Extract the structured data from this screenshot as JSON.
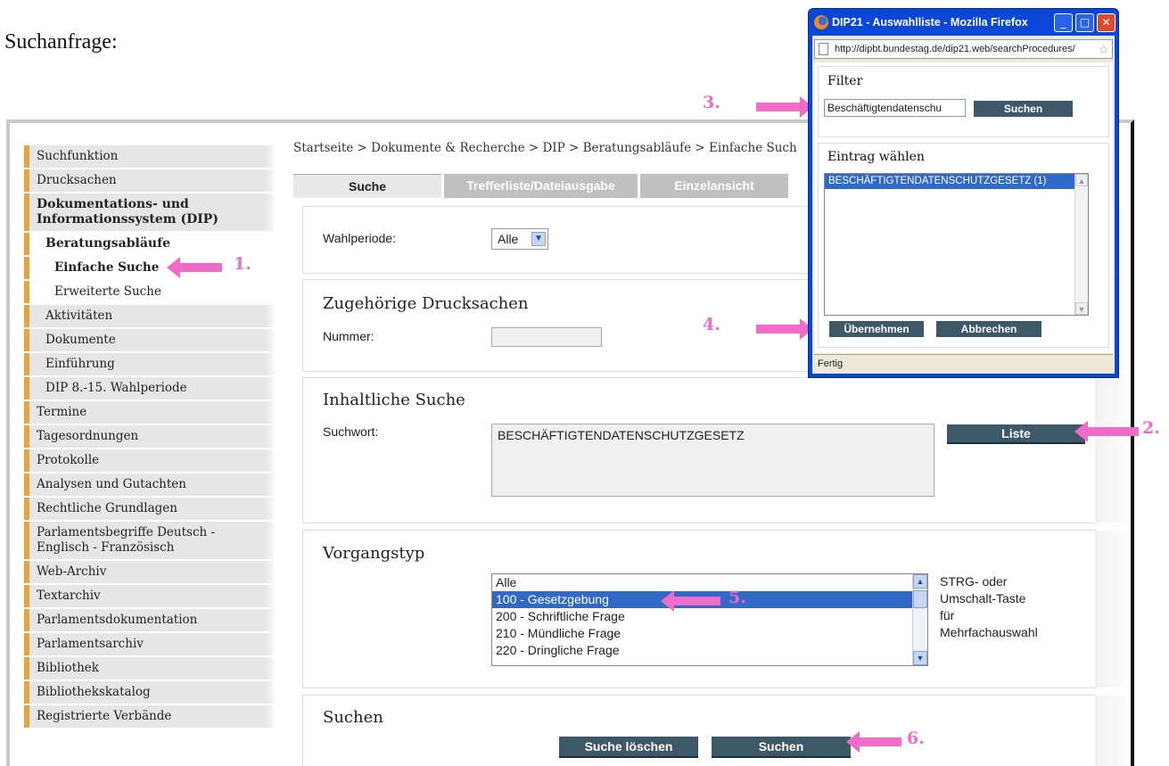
{
  "caption": "Suchanfrage:",
  "sidebar": {
    "items": [
      {
        "label": "Suchfunktion"
      },
      {
        "label": "Drucksachen"
      },
      {
        "label": "Dokumentations- und Informationssystem (DIP)"
      },
      {
        "label": "Beratungsabläufe"
      },
      {
        "label": "Einfache Suche"
      },
      {
        "label": "Erweiterte Suche"
      },
      {
        "label": "Aktivitäten"
      },
      {
        "label": "Dokumente"
      },
      {
        "label": "Einführung"
      },
      {
        "label": "DIP 8.-15. Wahlperiode"
      },
      {
        "label": "Termine"
      },
      {
        "label": "Tagesordnungen"
      },
      {
        "label": "Protokolle"
      },
      {
        "label": "Analysen und Gutachten"
      },
      {
        "label": "Rechtliche Grundlagen"
      },
      {
        "label": "Parlamentsbegriffe Deutsch - Englisch - Französisch"
      },
      {
        "label": "Web-Archiv"
      },
      {
        "label": "Textarchiv"
      },
      {
        "label": "Parlamentsdokumentation"
      },
      {
        "label": "Parlamentsarchiv"
      },
      {
        "label": "Bibliothek"
      },
      {
        "label": "Bibliothekskatalog"
      },
      {
        "label": "Registrierte Verbände"
      }
    ]
  },
  "breadcrumb": "Startseite > Dokumente & Recherche > DIP > Beratungsabläufe > Einfache Such",
  "tabs": [
    "Suche",
    "Trefferliste/Dateiausgabe",
    "Einzelansicht"
  ],
  "wahlperiode": {
    "label": "Wahlperiode:",
    "value": "Alle"
  },
  "drucksachen": {
    "title": "Zugehörige Drucksachen",
    "label": "Nummer:",
    "value": ""
  },
  "inhaltliche_suche": {
    "title": "Inhaltliche Suche",
    "label": "Suchwort:",
    "value": "BESCHÄFTIGTENDATENSCHUTZGESETZ",
    "button": "Liste"
  },
  "vorgangstyp": {
    "title": "Vorgangstyp",
    "options": [
      "Alle",
      "100 - Gesetzgebung",
      "200 - Schriftliche Frage",
      "210 - Mündliche Frage",
      "220 - Dringliche Frage"
    ],
    "selected": "100 - Gesetzgebung",
    "hint": [
      "STRG- oder",
      "Umschalt-Taste",
      "für",
      "Mehrfachauswahl"
    ]
  },
  "suchen": {
    "title": "Suchen",
    "clear_button": "Suche löschen",
    "search_button": "Suchen"
  },
  "annotations": [
    "1.",
    "2.",
    "3.",
    "4.",
    "5.",
    "6."
  ],
  "popup": {
    "window_title": "DIP21 - Auswahlliste - Mozilla Firefox",
    "url": "http://dipbt.bundestag.de/dip21.web/searchProcedures/",
    "filter_label": "Filter",
    "filter_value": "Beschäftigtendatenschu",
    "filter_button": "Suchen",
    "entry_label": "Eintrag wählen",
    "entry_item": "BESCHÄFTIGTENDATENSCHUTZGESETZ (1)",
    "apply_button": "Übernehmen",
    "cancel_button": "Abbrechen",
    "status": "Fertig"
  },
  "colors": {
    "accent": "#e8a33a",
    "button": "#3d5868",
    "annotation": "#f06cc8",
    "selection": "#3169c6"
  }
}
